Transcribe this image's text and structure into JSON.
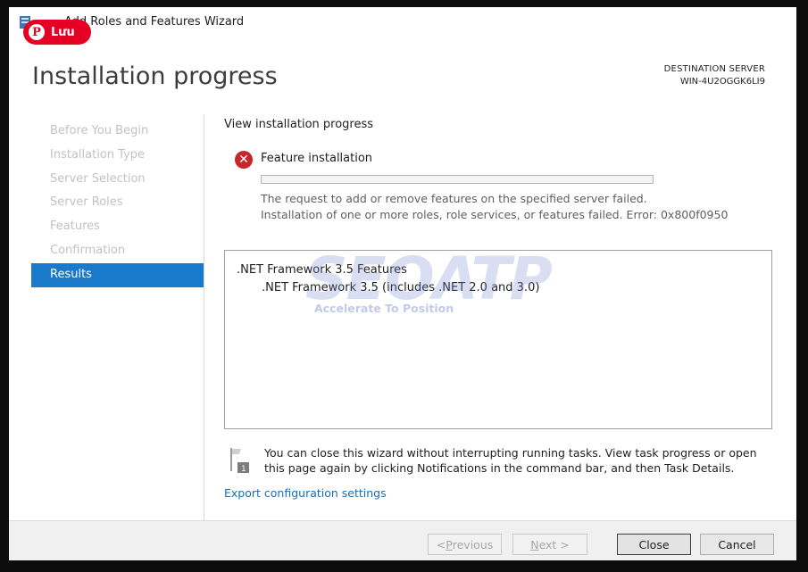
{
  "window": {
    "title": "Add Roles and Features Wizard",
    "page_title": "Installation progress",
    "destination": {
      "label": "DESTINATION SERVER",
      "value": "WIN-4U2OGGK6LI9"
    }
  },
  "overlay": {
    "pin_label": "Lưu",
    "watermark": "SEOATP",
    "watermark_tagline": "Accelerate To Position"
  },
  "nav": {
    "items": [
      {
        "label": "Before You Begin",
        "active": false
      },
      {
        "label": "Installation Type",
        "active": false
      },
      {
        "label": "Server Selection",
        "active": false
      },
      {
        "label": "Server Roles",
        "active": false
      },
      {
        "label": "Features",
        "active": false
      },
      {
        "label": "Confirmation",
        "active": false
      },
      {
        "label": "Results",
        "active": true
      }
    ]
  },
  "main": {
    "section_heading": "View installation progress",
    "feature": {
      "label": "Feature installation",
      "status": "error",
      "progress": 0,
      "message_line1": "The request to add or remove features on the specified server failed.",
      "message_line2": "Installation of one or more roles, role services, or features failed. Error: 0x800f0950"
    },
    "results": {
      "parent": ".NET Framework 3.5 Features",
      "child": ".NET Framework 3.5 (includes .NET 2.0 and 3.0)"
    },
    "notice": "You can close this wizard without interrupting running tasks. View task progress or open this page again by clicking Notifications in the command bar, and then Task Details.",
    "export_link": "Export configuration settings"
  },
  "footer": {
    "previous": {
      "prefix": "< ",
      "accel": "P",
      "rest": "revious"
    },
    "next": {
      "accel": "N",
      "rest": "ext >"
    },
    "close": "Close",
    "cancel": "Cancel"
  },
  "colors": {
    "accent": "#1979ca",
    "error": "#c8262a",
    "link": "#1b6db3",
    "pin": "#e60023"
  }
}
